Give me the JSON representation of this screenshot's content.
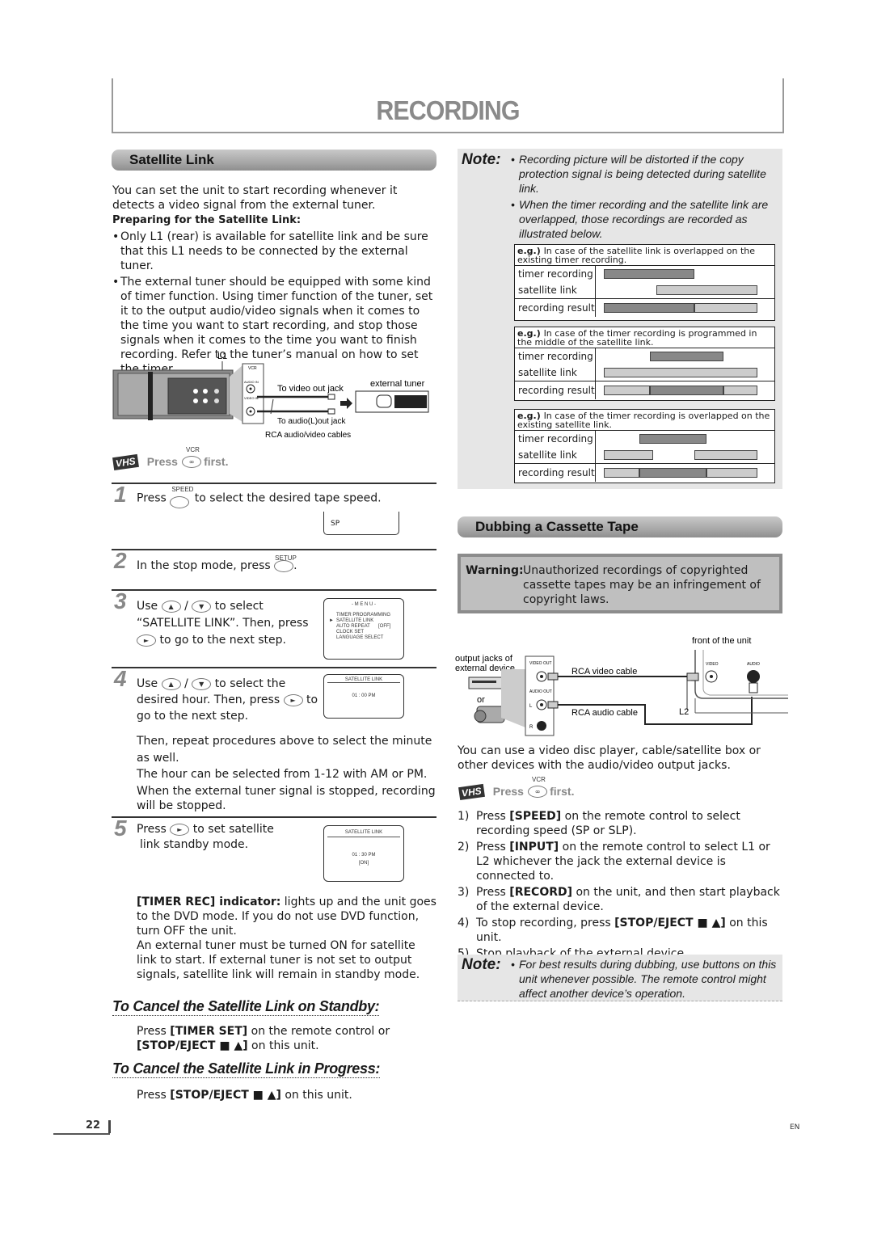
{
  "page": {
    "title": "RECORDING",
    "page_number": "22",
    "language": "EN"
  },
  "satellite_link": {
    "heading": "Satellite Link",
    "intro": "You can set the unit to start recording whenever it detects a video signal from the external tuner.",
    "preparing_heading": "Preparing for the Satellite Link:",
    "bullets": [
      "Only L1 (rear) is available for satellite link and be sure that this L1 needs to be connected by the external tuner.",
      "The external tuner should be equipped with some kind of timer function. Using timer function of the tuner, set it to the output audio/video signals when it comes to the time you want to start recording, and stop those signals when it comes to the time you want to finish recording. Refer to the tuner’s manual on how to set the timer."
    ],
    "diagram": {
      "l1_label": "L1",
      "vcr_label": "VCR",
      "audio_in": "AUDIO IN",
      "video_in": "VIDEO IN",
      "to_video_out": "To video out jack",
      "to_audio_out": "To audio(L)out jack",
      "cables": "RCA audio/video cables",
      "external_tuner": "external tuner"
    },
    "press_first": {
      "press": "Press",
      "button_label": "VCR",
      "first": "first.",
      "logo": "VHS"
    },
    "steps": [
      {
        "num": "1",
        "pre": "Press",
        "button_label": "SPEED",
        "post": "to select the desired tape speed.",
        "screen_text": "SP"
      },
      {
        "num": "2",
        "pre": "In the stop mode, press",
        "button_label": "SETUP",
        "post": "."
      },
      {
        "num": "3",
        "pre": "Use",
        "sep": "/",
        "post1": "to select",
        "line2": "“SATELLITE LINK”. Then, press",
        "line3": "to go to the next step.",
        "screen": {
          "title": "- M E N U -",
          "items": [
            "TIMER PROGRAMMING",
            "SATELLITE LINK",
            "AUTO REPEAT",
            "CLOCK SET",
            "LANGUAGE SELECT"
          ],
          "auto_repeat_value": "[OFF]",
          "selected_index": 1
        }
      },
      {
        "num": "4",
        "pre": "Use",
        "sep": "/",
        "post1": "to select the",
        "line2a": "desired hour. Then, press",
        "line2b": "to",
        "line3": "go to the next step.",
        "screen": {
          "title": "SATELLITE LINK",
          "time": "01 : 00 PM"
        },
        "extra": [
          "Then, repeat procedures above to select the minute as well.",
          "The hour can be selected from 1-12 with AM or PM.",
          "When the external tuner signal is stopped, recording will be stopped."
        ]
      },
      {
        "num": "5",
        "pre": "Press",
        "post": "to set satellite",
        "line2": "link standby mode.",
        "screen": {
          "title": "SATELLITE LINK",
          "time": "01 : 30  PM",
          "status": "[ON]"
        },
        "indicator_label": "[TIMER REC] indicator:",
        "indicator_text": " lights up and the unit goes to the DVD mode. If you do not use DVD function, turn OFF the unit.",
        "extra": "An external tuner must be turned ON for satellite link to start. If external tuner is not set to output signals, satellite link will remain in standby mode."
      }
    ],
    "cancel_standby": {
      "heading": "To Cancel the Satellite Link on Standby:",
      "line1_pre": "Press ",
      "line1_bold": "[TIMER SET]",
      "line1_post": " on the remote control or",
      "line2_bold": "[STOP/EJECT ■ ▲]",
      "line2_post": " on this unit."
    },
    "cancel_progress": {
      "heading": "To Cancel the Satellite Link in Progress:",
      "pre": "Press ",
      "bold": "[STOP/EJECT ■ ▲]",
      "post": " on this unit."
    }
  },
  "note_top": {
    "label": "Note:",
    "bullets": [
      "Recording picture will be distorted if the copy protection signal is being detected during satellite link.",
      "When the timer recording and the satellite link are overlapped, those recordings are recorded as illustrated below."
    ],
    "examples": [
      {
        "eg": "e.g.)",
        "text": "In case of the satellite link is overlapped on the existing timer recording.",
        "row_labels": [
          "timer recording",
          "satellite link",
          "recording result"
        ],
        "timer": [
          [
            0.0,
            0.59
          ]
        ],
        "satellite": [
          [
            0.34,
            1.0
          ]
        ],
        "result": [
          {
            "span": [
              0.0,
              0.59
            ],
            "type": "timer"
          },
          {
            "span": [
              0.59,
              1.0
            ],
            "type": "satellite"
          }
        ]
      },
      {
        "eg": "e.g.)",
        "text": "In case of the timer recording is programmed in the middle of the satellite link.",
        "row_labels": [
          "timer recording",
          "satellite link",
          "recording result"
        ],
        "timer": [
          [
            0.3,
            0.78
          ]
        ],
        "satellite": [
          [
            0.0,
            1.0
          ]
        ],
        "result": [
          {
            "span": [
              0.0,
              0.3
            ],
            "type": "satellite"
          },
          {
            "span": [
              0.3,
              0.78
            ],
            "type": "timer"
          },
          {
            "span": [
              0.78,
              1.0
            ],
            "type": "satellite"
          }
        ]
      },
      {
        "eg": "e.g.)",
        "text": "In case of the timer recording is overlapped on the existing satellite link.",
        "row_labels": [
          "timer recording",
          "satellite link",
          "recording result"
        ],
        "timer": [
          [
            0.23,
            0.67
          ]
        ],
        "satellite": [
          [
            0.0,
            0.32
          ],
          [
            0.59,
            1.0
          ]
        ],
        "result": [
          {
            "span": [
              0.0,
              0.23
            ],
            "type": "satellite"
          },
          {
            "span": [
              0.23,
              0.67
            ],
            "type": "timer"
          },
          {
            "span": [
              0.67,
              1.0
            ],
            "type": "satellite"
          }
        ]
      }
    ]
  },
  "dubbing": {
    "heading": "Dubbing a Cassette Tape",
    "warning_label": "Warning:",
    "warning_text": "Unauthorized recordings of copyrighted cassette tapes may be an infringement of copyright laws.",
    "diagram": {
      "output_jacks": "output jacks of",
      "external_device": "external device",
      "or": "or",
      "video_out": "VIDEO OUT",
      "audio_out": "AUDIO OUT",
      "l": "L",
      "r": "R",
      "rca_video": "RCA video cable",
      "rca_audio": "RCA audio cable",
      "front": "front of the unit",
      "video": "VIDEO",
      "audio": "AUDIO",
      "l2": "L2"
    },
    "intro": "You can use a video disc player, cable/satellite box or other devices with the audio/video output jacks.",
    "press_first": {
      "press": "Press",
      "button_label": "VCR",
      "first": "first.",
      "logo": "VHS"
    },
    "steps": [
      {
        "n": "1)",
        "pre": "Press ",
        "bold": "[SPEED]",
        "post": " on the remote control to select recording speed (SP or SLP)."
      },
      {
        "n": "2)",
        "pre": "Press ",
        "bold": "[INPUT]",
        "post": " on the remote control to select L1 or L2 whichever the jack the external device is connected to."
      },
      {
        "n": "3)",
        "pre": "Press ",
        "bold": "[RECORD]",
        "post": " on the unit, and then start playback of the external device."
      },
      {
        "n": "4)",
        "pre": "To stop recording, press ",
        "bold": "[STOP/EJECT ■ ▲]",
        "post": " on this unit."
      },
      {
        "n": "5)",
        "pre": "Stop playback of the external device.",
        "bold": "",
        "post": ""
      }
    ],
    "note": {
      "label": "Note:",
      "text": "For best results during dubbing, use buttons on this unit whenever possible. The remote control might affect another device’s operation."
    }
  }
}
